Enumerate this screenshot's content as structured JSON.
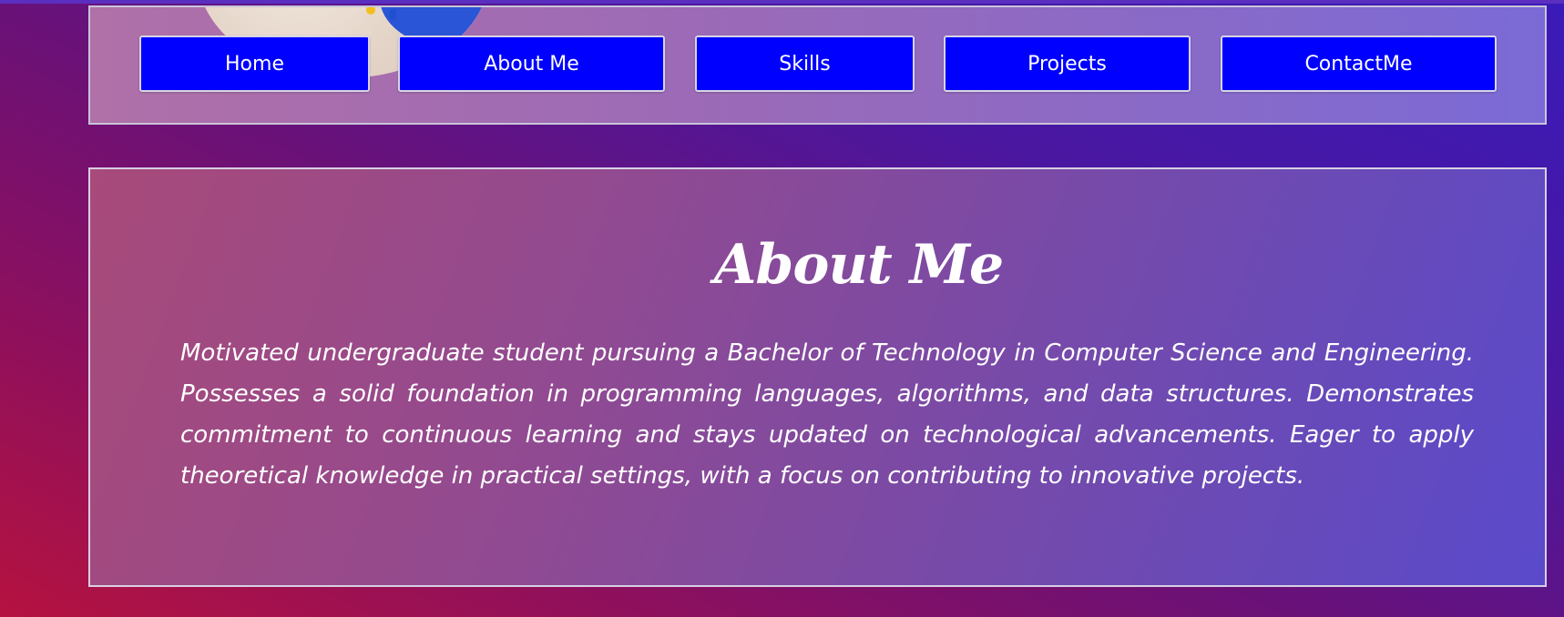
{
  "nav": {
    "items": [
      {
        "label": "Home"
      },
      {
        "label": "About Me"
      },
      {
        "label": "Skills"
      },
      {
        "label": "Projects"
      },
      {
        "label": "ContactMe"
      }
    ]
  },
  "about": {
    "title": "About Me",
    "body": "Motivated undergraduate student pursuing a Bachelor of Technology in Computer Science and Engineering. Possesses a solid foundation in programming languages, algorithms, and data structures. Demonstrates commitment to continuous learning and stays updated on technological advancements. Eager to apply theoretical knowledge in practical settings, with a focus on contributing to innovative projects."
  },
  "colors": {
    "button_bg": "#0000ff",
    "button_text": "#ffffff",
    "panel_border": "#d6d0e4",
    "background_start": "#b51240",
    "background_end": "#3a1ab8"
  },
  "icons": {
    "profile_image": "profile-photo"
  }
}
